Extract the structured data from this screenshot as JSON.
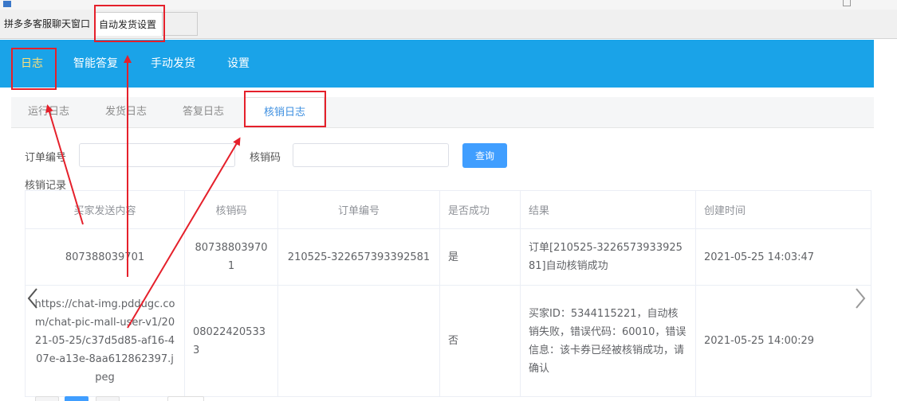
{
  "window": {
    "tabs": [
      {
        "label": "拼多多客服聊天窗口"
      },
      {
        "label": "自动发货设置"
      },
      {
        "label": ""
      }
    ]
  },
  "nav": {
    "items": [
      {
        "label": "日志",
        "active": true
      },
      {
        "label": "智能答复",
        "active": false
      },
      {
        "label": "手动发货",
        "active": false
      },
      {
        "label": "设置",
        "active": false
      }
    ]
  },
  "subtabs": [
    {
      "label": "运行日志",
      "active": false
    },
    {
      "label": "发货日志",
      "active": false
    },
    {
      "label": "答复日志",
      "active": false
    },
    {
      "label": "核销日志",
      "active": true
    }
  ],
  "search": {
    "order_label": "订单编号",
    "order_value": "",
    "code_label": "核销码",
    "code_value": "",
    "query_button": "查询"
  },
  "records": {
    "title": "核销记录",
    "columns": [
      "买家发送内容",
      "核销码",
      "订单编号",
      "是否成功",
      "结果",
      "创建时间"
    ],
    "rows": [
      {
        "content": "807388039701",
        "code": "807388039701",
        "order": "210525-322657393392581",
        "success": "是",
        "result": "订单[210525-322657393392581]自动核销成功",
        "created": "2021-05-25 14:03:47"
      },
      {
        "content": "https://chat-img.pddugc.com/chat-pic-mall-user-v1/2021-05-25/c37d5d85-af16-407e-a13e-8aa612862397.jpeg",
        "code": "080224205333",
        "order": "",
        "success": "否",
        "result": "买家ID：5344115221，自动核销失败，错误代码：60010，错误信息：该卡券已经被核销成功，请确认",
        "created": "2021-05-25 14:00:29"
      }
    ]
  },
  "colors": {
    "nav_bg": "#1aa3e8",
    "nav_active": "#ffe07a",
    "primary": "#409eff",
    "annotation": "#e5202b",
    "success": "#2e9a3e",
    "fail": "#e23b2b"
  },
  "icons": {
    "prev": "chevron-left-icon",
    "next": "chevron-right-icon"
  }
}
